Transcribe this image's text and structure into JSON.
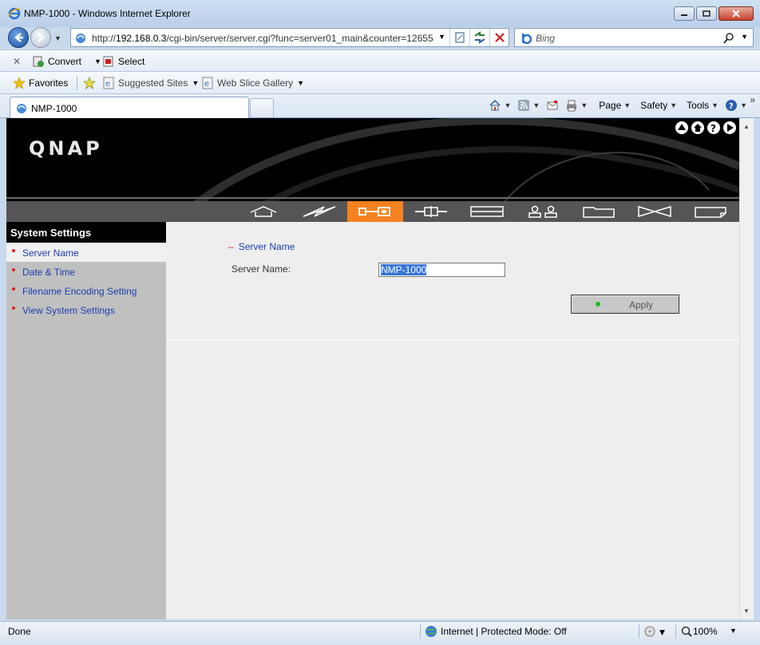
{
  "window": {
    "title": "NMP-1000 - Windows Internet Explorer"
  },
  "address": {
    "url_prefix": "http://",
    "url_host": "192.168.0.3",
    "url_path": "/cgi-bin/server/server.cgi?func=server01_main&counter=12655!"
  },
  "search": {
    "placeholder": "Bing"
  },
  "commandbar": {
    "convert_label": "Convert",
    "select_label": "Select"
  },
  "favorites": {
    "favorites_label": "Favorites",
    "suggested_label": "Suggested Sites",
    "webslice_label": "Web Slice Gallery"
  },
  "tabs": [
    {
      "label": "NMP-1000"
    }
  ],
  "toolbar": {
    "page_label": "Page",
    "safety_label": "Safety",
    "tools_label": "Tools"
  },
  "page": {
    "logo_text": "QNAP",
    "sidebar": {
      "header": "System Settings",
      "items": [
        {
          "label": "Server Name"
        },
        {
          "label": "Date & Time"
        },
        {
          "label": "Filename Encoding Setting"
        },
        {
          "label": "View System Settings"
        }
      ]
    },
    "main": {
      "section_title": "Server Name",
      "field_label": "Server Name:",
      "field_value": "NMP-1000",
      "apply_label": "Apply"
    }
  },
  "status": {
    "text": "Done",
    "zone": "Internet | Protected Mode: Off",
    "zoom": "100%"
  },
  "colors": {
    "accent_active_nav": "#f58220",
    "link_blue": "#1a3fae",
    "bullet_red": "#dd2222"
  }
}
